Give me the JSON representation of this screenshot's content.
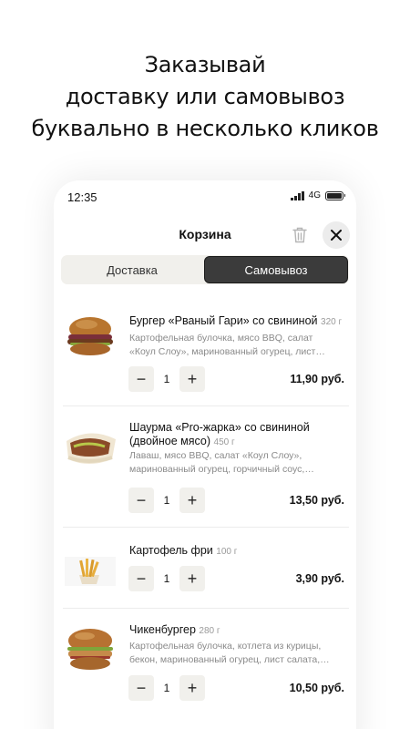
{
  "headline": {
    "line1": "Заказывай",
    "line2": "доставку или самовывоз",
    "line3": "буквально в несколько кликов"
  },
  "status_bar": {
    "time": "12:35",
    "network": "4G"
  },
  "header": {
    "title": "Корзина"
  },
  "tabs": [
    {
      "label": "Доставка",
      "active": false
    },
    {
      "label": "Самовывоз",
      "active": true
    }
  ],
  "cart": {
    "items": [
      {
        "name": "Бургер «Рваный Гари» со свининой",
        "weight": "320 г",
        "desc1": "Картофельная булочка, мясо BBQ, салат",
        "desc2": "«Коул Слоу», маринованный огурец, лист…",
        "qty": "1",
        "price": "11,90 руб."
      },
      {
        "name": "Шаурма «Pro-жарка» со свининой",
        "name2": "(двойное мясо)",
        "weight": "450 г",
        "desc1": "Лаваш, мясо BBQ, салат «Коул Слоу»,",
        "desc2": "маринованный огурец, горчичный соус,…",
        "qty": "1",
        "price": "13,50 руб."
      },
      {
        "name": "Картофель фри",
        "weight": "100 г",
        "qty": "1",
        "price": "3,90 руб."
      },
      {
        "name": "Чикенбургер",
        "weight": "280 г",
        "desc1": "Картофельная булочка, котлета из курицы,",
        "desc2": "бекон, маринованный огурец, лист салата,…",
        "qty": "1",
        "price": "10,50 руб."
      }
    ],
    "minus_label": "−",
    "plus_label": "+"
  }
}
